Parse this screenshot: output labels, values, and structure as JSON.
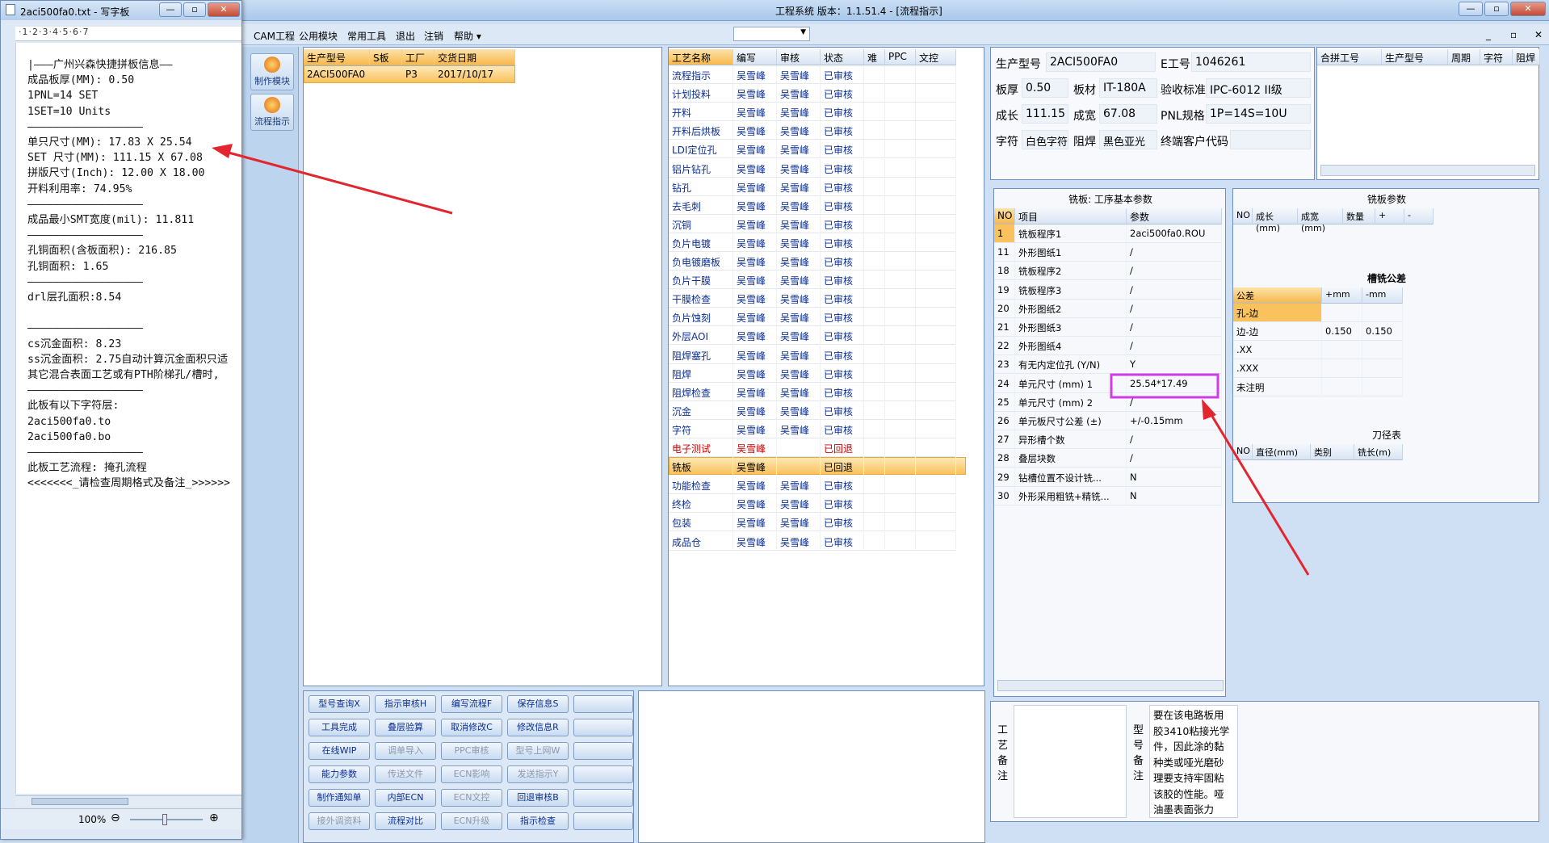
{
  "main_window": {
    "title": "工程系统  版本：1.1.51.4 - [流程指示]",
    "controls": {
      "minimize": "—",
      "restore": "▫",
      "close": "✕"
    }
  },
  "menubar": [
    "CAM工程",
    "公用模块",
    "常用工具",
    "退出",
    "注销",
    "帮助 ▾"
  ],
  "menubar_right": [
    "_",
    "▫",
    "✕"
  ],
  "sidebar": [
    {
      "label": "制作模块",
      "icon": "flame-icon"
    },
    {
      "label": "流程指示",
      "icon": "pause-icon"
    }
  ],
  "model_table": {
    "headers": [
      "生产型号",
      "S板",
      "工厂",
      "交货日期"
    ],
    "rows": [
      [
        "2ACI500FA0",
        "",
        "P3",
        "2017/10/17"
      ]
    ]
  },
  "process_table": {
    "headers": [
      "工艺名称",
      "编写",
      "审核",
      "状态",
      "难",
      "PPC",
      "文控"
    ],
    "rows": [
      [
        "流程指示",
        "吴雪峰",
        "吴雪峰",
        "已审核"
      ],
      [
        "计划投料",
        "吴雪峰",
        "吴雪峰",
        "已审核"
      ],
      [
        "开料",
        "吴雪峰",
        "吴雪峰",
        "已审核"
      ],
      [
        "开料后烘板",
        "吴雪峰",
        "吴雪峰",
        "已审核"
      ],
      [
        "LDI定位孔",
        "吴雪峰",
        "吴雪峰",
        "已审核"
      ],
      [
        "铝片钻孔",
        "吴雪峰",
        "吴雪峰",
        "已审核"
      ],
      [
        "钻孔",
        "吴雪峰",
        "吴雪峰",
        "已审核"
      ],
      [
        "去毛刺",
        "吴雪峰",
        "吴雪峰",
        "已审核"
      ],
      [
        "沉铜",
        "吴雪峰",
        "吴雪峰",
        "已审核"
      ],
      [
        "负片电镀",
        "吴雪峰",
        "吴雪峰",
        "已审核"
      ],
      [
        "负电镀磨板",
        "吴雪峰",
        "吴雪峰",
        "已审核"
      ],
      [
        "负片干膜",
        "吴雪峰",
        "吴雪峰",
        "已审核"
      ],
      [
        "干膜检查",
        "吴雪峰",
        "吴雪峰",
        "已审核"
      ],
      [
        "负片蚀刻",
        "吴雪峰",
        "吴雪峰",
        "已审核"
      ],
      [
        "外层AOI",
        "吴雪峰",
        "吴雪峰",
        "已审核"
      ],
      [
        "阻焊塞孔",
        "吴雪峰",
        "吴雪峰",
        "已审核"
      ],
      [
        "阻焊",
        "吴雪峰",
        "吴雪峰",
        "已审核"
      ],
      [
        "阻焊检查",
        "吴雪峰",
        "吴雪峰",
        "已审核"
      ],
      [
        "沉金",
        "吴雪峰",
        "吴雪峰",
        "已审核"
      ],
      [
        "字符",
        "吴雪峰",
        "吴雪峰",
        "已审核"
      ],
      [
        "电子测试",
        "吴雪峰",
        "",
        "已回退"
      ],
      [
        "铣板",
        "吴雪峰",
        "",
        "已回退"
      ],
      [
        "功能检查",
        "吴雪峰",
        "吴雪峰",
        "已审核"
      ],
      [
        "终检",
        "吴雪峰",
        "吴雪峰",
        "已审核"
      ],
      [
        "包装",
        "吴雪峰",
        "吴雪峰",
        "已审核"
      ],
      [
        "成品仓",
        "吴雪峰",
        "吴雪峰",
        "已审核"
      ]
    ]
  },
  "action_buttons": [
    [
      {
        "t": "型号查询X",
        "d": false
      },
      {
        "t": "指示审核H",
        "d": false
      },
      {
        "t": "编写流程F",
        "d": false
      },
      {
        "t": "保存信息S",
        "d": false
      },
      {
        "t": "",
        "d": false
      }
    ],
    [
      {
        "t": "工具完成",
        "d": false
      },
      {
        "t": "叠层验算",
        "d": false
      },
      {
        "t": "取消修改C",
        "d": false
      },
      {
        "t": "修改信息R",
        "d": false
      },
      {
        "t": "",
        "d": false
      }
    ],
    [
      {
        "t": "在线WIP",
        "d": false
      },
      {
        "t": "调单导入",
        "d": true
      },
      {
        "t": "PPC审核",
        "d": true
      },
      {
        "t": "型号上网W",
        "d": true
      },
      {
        "t": "",
        "d": false
      }
    ],
    [
      {
        "t": "能力参数",
        "d": false
      },
      {
        "t": "传送文件",
        "d": true
      },
      {
        "t": "ECN影响",
        "d": true
      },
      {
        "t": "发送指示Y",
        "d": true
      },
      {
        "t": "",
        "d": false
      }
    ],
    [
      {
        "t": "制作通知单",
        "d": false
      },
      {
        "t": "内部ECN",
        "d": false
      },
      {
        "t": "ECN文控",
        "d": true
      },
      {
        "t": "回退审核B",
        "d": false
      },
      {
        "t": "",
        "d": false
      }
    ],
    [
      {
        "t": "接外调资料",
        "d": true
      },
      {
        "t": "流程对比",
        "d": false
      },
      {
        "t": "ECN升级",
        "d": true
      },
      {
        "t": "指示检查",
        "d": false
      },
      {
        "t": "",
        "d": false
      }
    ]
  ],
  "info": {
    "prod_model_label": "生产型号",
    "prod_model": "2ACI500FA0",
    "e_no_label": "E工号",
    "e_no": "1046261",
    "thickness_label": "板厚",
    "thickness": "0.50",
    "material_label": "板材",
    "material": "IT-180A",
    "standard_label": "验收标准",
    "standard": "IPC-6012 II级",
    "len_label": "成长",
    "len": "111.15",
    "width_label": "成宽",
    "width": "67.08",
    "pnl_label": "PNL规格",
    "pnl": "1P=14S=10U",
    "char_label": "字符",
    "char": "白色字符",
    "mask_label": "阻焊",
    "mask": "黑色亚光",
    "customer_label": "终端客户代码",
    "customer": ""
  },
  "merge_table": {
    "headers": [
      "合拼工号",
      "生产型号",
      "周期",
      "字符",
      "阻焊"
    ]
  },
  "mill_params": {
    "title": "铣板: 工序基本参数",
    "headers": [
      "NO",
      "项目",
      "参数"
    ],
    "rows": [
      [
        "1",
        "铣板程序1",
        "2aci500fa0.ROU"
      ],
      [
        "11",
        "外形图纸1",
        "/"
      ],
      [
        "18",
        "铣板程序2",
        "/"
      ],
      [
        "19",
        "铣板程序3",
        "/"
      ],
      [
        "20",
        "外形图纸2",
        "/"
      ],
      [
        "21",
        "外形图纸3",
        "/"
      ],
      [
        "22",
        "外形图纸4",
        "/"
      ],
      [
        "23",
        "有无内定位孔 (Y/N)",
        "Y"
      ],
      [
        "24",
        "单元尺寸 (mm) 1",
        "25.54*17.49"
      ],
      [
        "25",
        "单元尺寸 (mm) 2",
        "/"
      ],
      [
        "26",
        "单元板尺寸公差 (±)",
        "+/-0.15mm"
      ],
      [
        "27",
        "异形槽个数",
        "/"
      ],
      [
        "28",
        "叠层块数",
        "/"
      ],
      [
        "29",
        "钻槽位置不设计铣...",
        "N"
      ],
      [
        "30",
        "外形采用粗铣+精铣...",
        "N"
      ]
    ]
  },
  "plate_params": {
    "title": "铣板参数",
    "headers": [
      "NO",
      "成长(mm)",
      "成宽(mm)",
      "数量",
      "+",
      "-"
    ]
  },
  "slot_tol": {
    "title": "槽铣公差",
    "headers": [
      "公差",
      "+mm",
      "-mm"
    ],
    "rows": [
      [
        "孔-边",
        "",
        ""
      ],
      [
        "边-边",
        "0.150",
        "0.150"
      ],
      [
        ".XX",
        "",
        ""
      ],
      [
        ".XXX",
        "",
        ""
      ],
      [
        "未注明",
        "",
        ""
      ]
    ]
  },
  "tool_table": {
    "title": "刀径表",
    "headers": [
      "NO",
      "直径(mm)",
      "类别",
      "铣长(m)"
    ]
  },
  "remarks": {
    "process_label": "工艺备注",
    "model_label": "型号备注",
    "model_text": [
      "要在该电路板用",
      "胶3410粘接光学",
      "件，因此涂的黏",
      "种类或哑光磨砂",
      "理要支持牢固粘",
      "该胶的性能。哑",
      "油墨表面张力"
    ]
  },
  "notepad": {
    "title": "2aci500fa0.txt - 写字板",
    "ruler": "·1·2·3·4·5·6·7",
    "lines": [
      "|———广州兴森快捷拼板信息——",
      "成品板厚(MM): 0.50",
      "1PNL=14 SET",
      "1SET=10 Units",
      "——————————————————",
      "单只尺寸(MM): 17.83 X 25.54",
      "SET 尺寸(MM): 111.15 X 67.08",
      "拼版尺寸(Inch): 12.00 X 18.00",
      "开料利用率: 74.95%",
      "——————————————————",
      "成品最小SMT宽度(mil): 11.811",
      "——————————————————",
      "孔铜面积(含板面积): 216.85",
      "孔铜面积: 1.65",
      "——————————————————",
      "drl层孔面积:8.54",
      "",
      "——————————————————",
      "cs沉金面积: 8.23",
      "ss沉金面积: 2.75自动计算沉金面积只适",
      "其它混合表面工艺或有PTH阶梯孔/槽时,",
      "——————————————————",
      "此板有以下字符层:",
      "2aci500fa0.to",
      "2aci500fa0.bo",
      "——————————————————",
      "此板工艺流程: 掩孔流程",
      "<<<<<<<_请检查周期格式及备注_>>>>>>"
    ],
    "zoom": "100%"
  },
  "colors": {
    "annotation_red": "#e3262e",
    "highlight_magenta": "#d13be6",
    "accent_orange": "#f7b84e"
  }
}
